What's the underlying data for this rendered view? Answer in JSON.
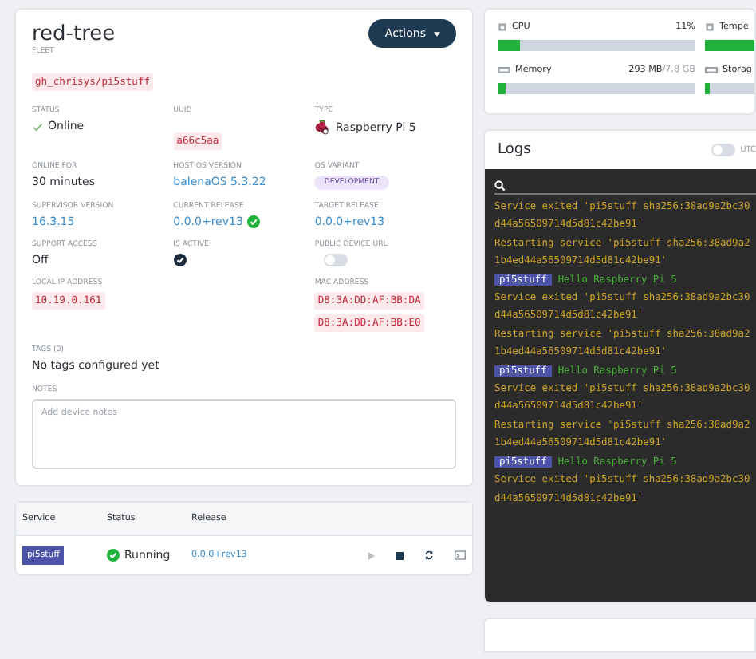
{
  "device": {
    "name": "red-tree",
    "actions": "Actions",
    "fleet": {
      "label": "FLEET",
      "value": "gh_chrisys/pi5stuff"
    },
    "rows": [
      [
        {
          "label": "STATUS",
          "kind": "status",
          "value": "Online"
        },
        {
          "label": "UUID",
          "kind": "code",
          "value": "a66c5aa"
        },
        {
          "label": "TYPE",
          "kind": "device-type",
          "value": "Raspberry Pi 5"
        }
      ],
      [
        {
          "label": "ONLINE FOR",
          "kind": "text",
          "value": "30 minutes"
        },
        {
          "label": "HOST OS VERSION",
          "kind": "link",
          "value": "balenaOS 5.3.22"
        },
        {
          "label": "OS VARIANT",
          "kind": "badge",
          "value": "DEVELOPMENT"
        }
      ],
      [
        {
          "label": "SUPERVISOR VERSION",
          "kind": "link",
          "value": "16.3.15"
        },
        {
          "label": "CURRENT RELEASE",
          "kind": "link-ok",
          "value": "0.0.0+rev13"
        },
        {
          "label": "TARGET RELEASE",
          "kind": "link",
          "value": "0.0.0+rev13"
        }
      ],
      [
        {
          "label": "SUPPORT ACCESS",
          "kind": "text",
          "value": "Off"
        },
        {
          "label": "IS ACTIVE",
          "kind": "check",
          "checked": true
        },
        {
          "label": "PUBLIC DEVICE URL",
          "kind": "toggle",
          "on": false
        }
      ],
      [
        {
          "label": "LOCAL IP ADDRESS",
          "kind": "codes",
          "values": [
            "10.19.0.161"
          ]
        },
        null,
        {
          "label": "MAC ADDRESS",
          "kind": "codes",
          "values": [
            "D8:3A:DD:AF:BB:DA",
            "D8:3A:DD:AF:BB:E0"
          ]
        }
      ]
    ],
    "tags": {
      "label": "TAGS (0)",
      "value": "No tags configured yet"
    },
    "notes": {
      "label": "NOTES",
      "placeholder": "Add device notes"
    }
  },
  "services": {
    "columns": [
      "Service",
      "Status",
      "Release"
    ],
    "rows": [
      {
        "service": "pi5stuff",
        "status": "Running",
        "release": "0.0.0+rev13"
      }
    ]
  },
  "metrics": [
    {
      "name": "CPU",
      "reading": "11%",
      "level": 0.11
    },
    {
      "name": "Tempe",
      "level": 0.3
    },
    {
      "name": "Memory",
      "reading": "293 MB",
      "reading_total": "/7.8 GB",
      "level": 0.04
    },
    {
      "name": "Storag",
      "level": 0.02
    }
  ],
  "logs": {
    "title": "Logs",
    "utc": {
      "label": "UTC",
      "on": false
    },
    "entries": [
      {
        "kind": "system",
        "lines": [
          "Service exited 'pi5stuff sha256:38ad9a2bc30",
          "d44a56509714d5d81c42be91'"
        ]
      },
      {
        "kind": "system",
        "lines": [
          "Restarting service 'pi5stuff sha256:38ad9a2",
          "1b4ed44a56509714d5d81c42be91'"
        ]
      },
      {
        "kind": "app",
        "service": "pi5stuff",
        "message": "Hello Raspberry Pi 5"
      },
      {
        "kind": "system",
        "lines": [
          "Service exited 'pi5stuff sha256:38ad9a2bc30",
          "d44a56509714d5d81c42be91'"
        ]
      },
      {
        "kind": "system",
        "lines": [
          "Restarting service 'pi5stuff sha256:38ad9a2",
          "1b4ed44a56509714d5d81c42be91'"
        ]
      },
      {
        "kind": "app",
        "service": "pi5stuff",
        "message": "Hello Raspberry Pi 5"
      },
      {
        "kind": "system",
        "lines": [
          "Service exited 'pi5stuff sha256:38ad9a2bc30",
          "d44a56509714d5d81c42be91'"
        ]
      },
      {
        "kind": "system",
        "lines": [
          "Restarting service 'pi5stuff sha256:38ad9a2",
          "1b4ed44a56509714d5d81c42be91'"
        ]
      },
      {
        "kind": "app",
        "service": "pi5stuff",
        "message": "Hello Raspberry Pi 5"
      },
      {
        "kind": "system",
        "lines": [
          "Service exited 'pi5stuff sha256:38ad9a2bc30",
          "d44a56509714d5d81c42be91'"
        ]
      }
    ]
  }
}
